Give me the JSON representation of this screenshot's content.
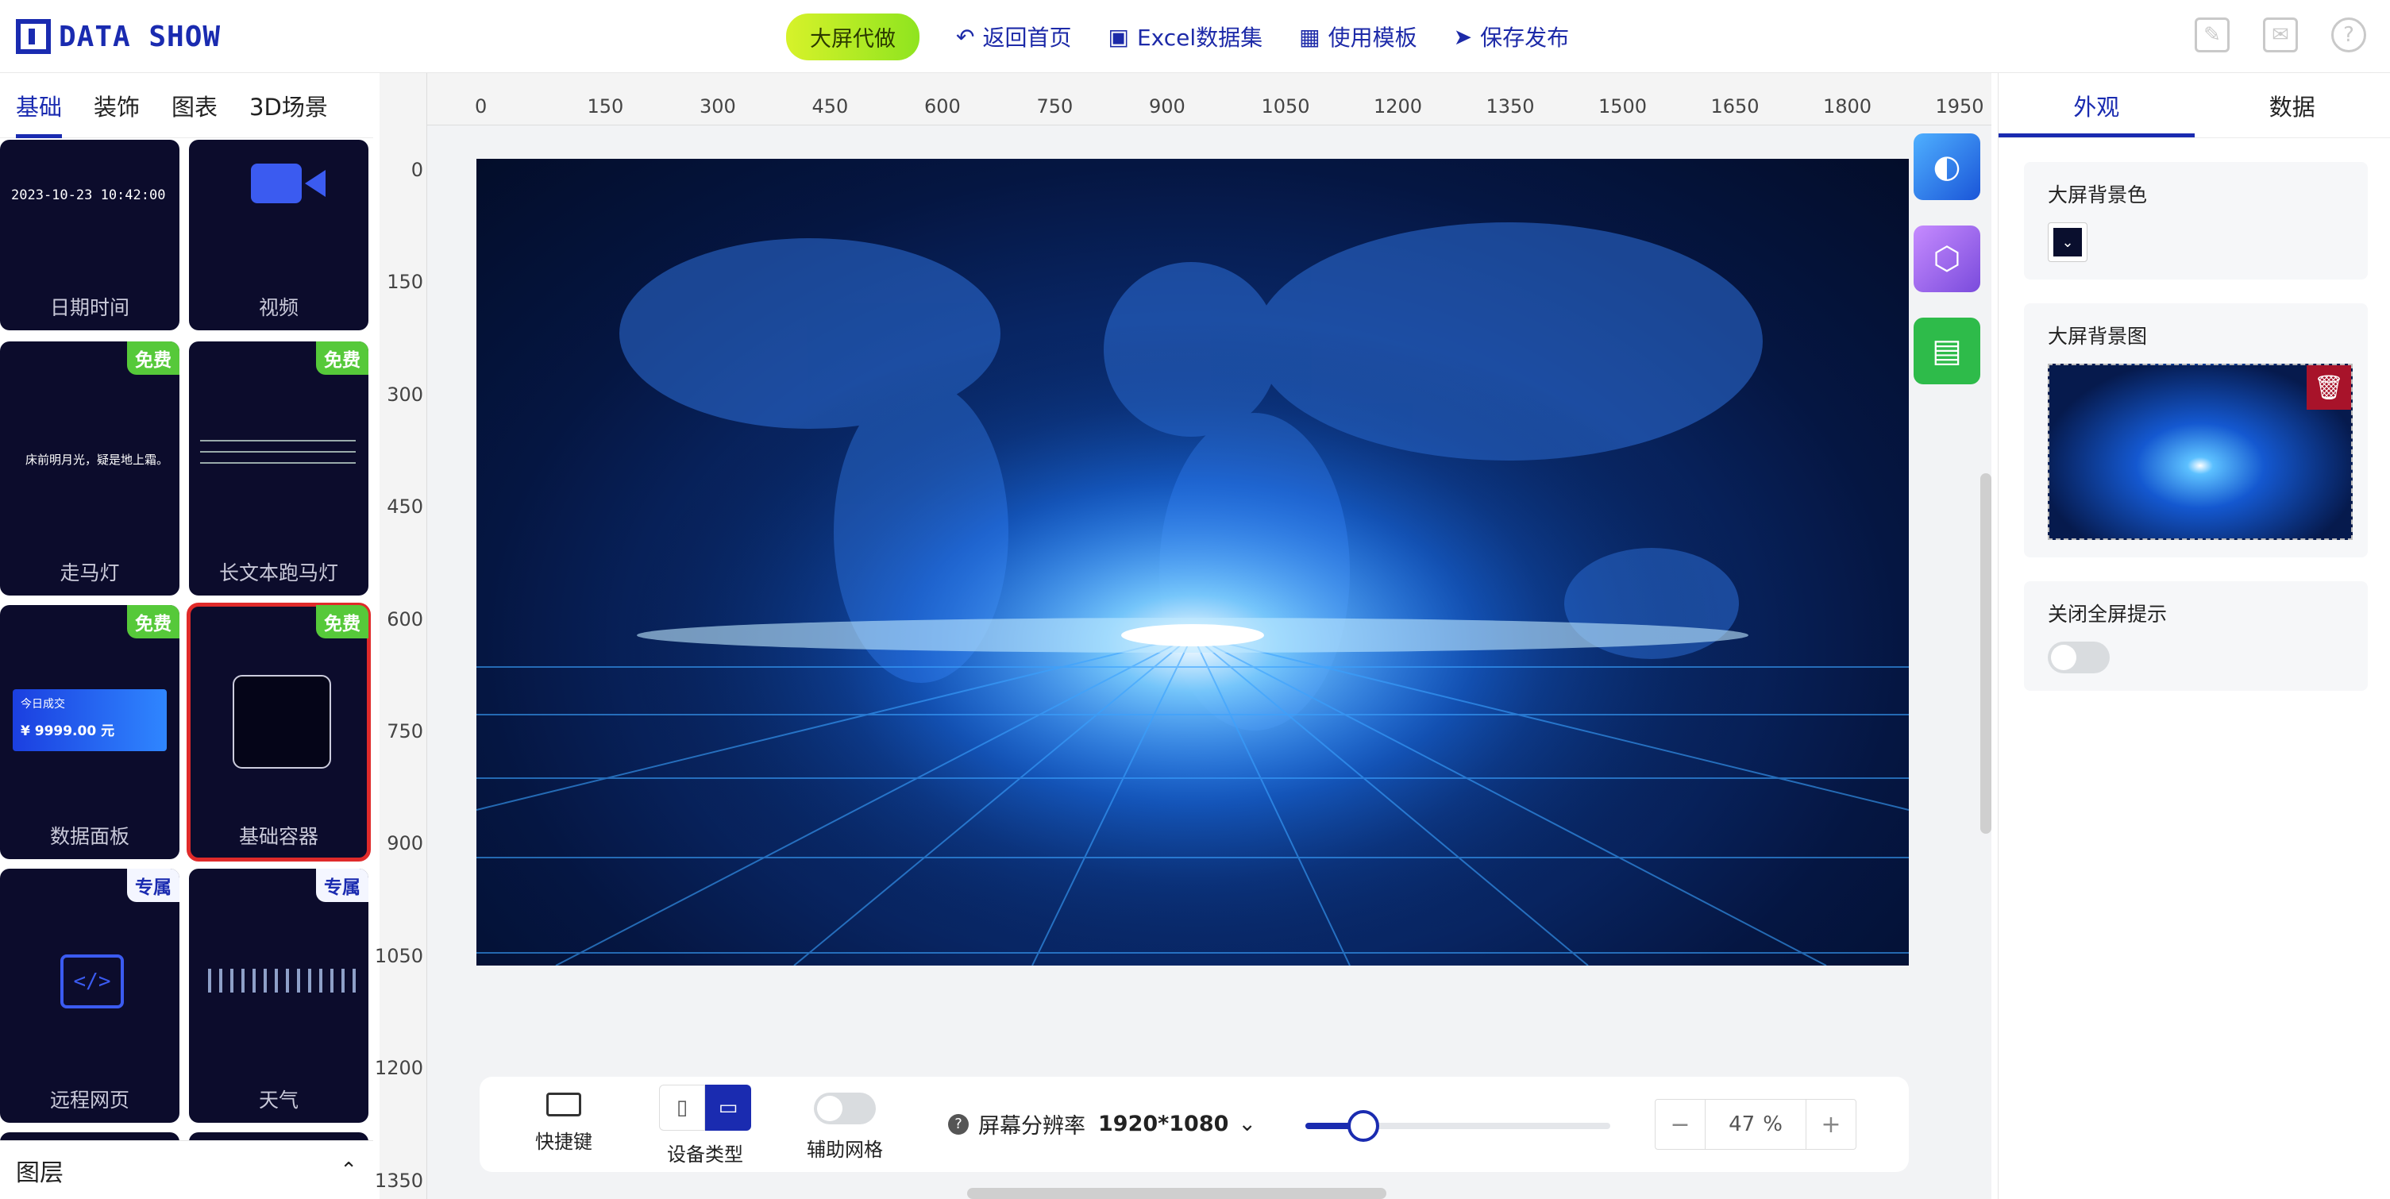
{
  "header": {
    "logo_text": "DATA SHOW",
    "pill_label": "大屏代做",
    "nav": [
      "返回首页",
      "Excel数据集",
      "使用模板",
      "保存发布"
    ]
  },
  "left_tabs": [
    "基础",
    "装饰",
    "图表",
    "3D场景"
  ],
  "components": [
    {
      "label": "日期时间",
      "preview": "2023-10-23 10:42:00",
      "badge": ""
    },
    {
      "label": "视频",
      "badge": ""
    },
    {
      "label": "走马灯",
      "preview": "床前明月光，疑是地上霜。",
      "badge": "免费"
    },
    {
      "label": "长文本跑马灯",
      "badge": "免费"
    },
    {
      "label": "数据面板",
      "preview_title": "今日成交",
      "preview_value": "¥  9999.00  元",
      "badge": "免费"
    },
    {
      "label": "基础容器",
      "badge": "免费"
    },
    {
      "label": "远程网页",
      "badge": "专属"
    },
    {
      "label": "天气",
      "badge": "专属"
    }
  ],
  "layers_label": "图层",
  "ruler": {
    "h_labels": [
      "0",
      "150",
      "300",
      "450",
      "600",
      "750",
      "900",
      "1050",
      "1200",
      "1350",
      "1500",
      "1650",
      "1800",
      "1950"
    ],
    "v_labels": [
      "0",
      "150",
      "300",
      "450",
      "600",
      "750",
      "900",
      "1050",
      "1200",
      "1350"
    ]
  },
  "bottombar": {
    "shortcut_label": "快捷键",
    "device_label": "设备类型",
    "grid_label": "辅助网格",
    "resolution_label": "屏幕分辨率",
    "resolution_value": "1920*1080",
    "zoom_value": "47",
    "zoom_unit": "%",
    "zoom_slider_fraction": 0.19
  },
  "right_panel": {
    "tabs": [
      "外观",
      "数据"
    ],
    "bg_color_label": "大屏背景色",
    "bg_image_label": "大屏背景图",
    "fullscreen_tip_label": "关闭全屏提示"
  }
}
